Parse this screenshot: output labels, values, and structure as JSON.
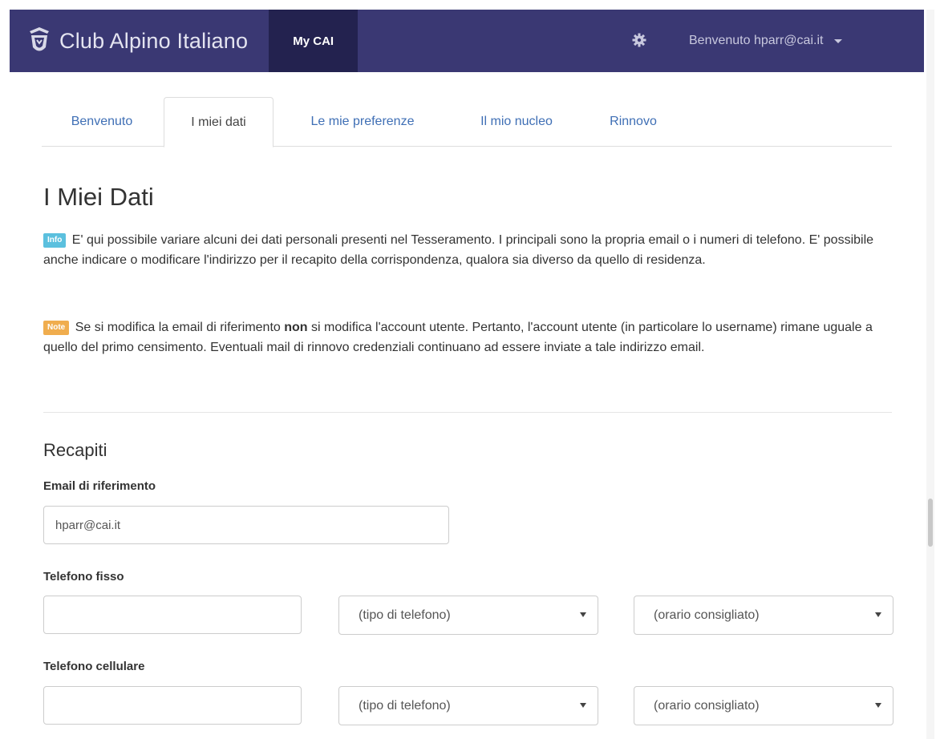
{
  "navbar": {
    "brand": "Club Alpino Italiano",
    "my_cai": "My CAI",
    "user_greeting": "Benvenuto hparr@cai.it",
    "icons": [
      "cai-logo-icon",
      "gear-icon",
      "caret-down-icon"
    ],
    "background_color": "#3a3873",
    "active_background_color": "#23224f"
  },
  "tabs": [
    {
      "label": "Benvenuto",
      "active": false
    },
    {
      "label": "I miei dati",
      "active": true
    },
    {
      "label": "Le mie preferenze",
      "active": false
    },
    {
      "label": "Il mio nucleo",
      "active": false
    },
    {
      "label": "Rinnovo",
      "active": false
    }
  ],
  "page": {
    "title": "I Miei Dati",
    "info_badge": "Info",
    "info_text": "E' qui possibile variare alcuni dei dati personali presenti nel Tesseramento. I principali sono la propria email o i numeri di telefono. E' possibile anche indicare o modificare l'indirizzo per il recapito della corrispondenza, qualora sia diverso da quello di residenza.",
    "note_badge": "Note",
    "note_text_before": "Se si modifica la email di riferimento ",
    "note_text_bold": "non",
    "note_text_after": " si modifica l'account utente. Pertanto, l'account utente (in particolare lo username) rimane uguale a quello del primo censimento. Eventuali mail di rinnovo credenziali continuano ad essere inviate a tale indirizzo email."
  },
  "recapiti": {
    "section_title": "Recapiti",
    "email": {
      "label": "Email di riferimento",
      "value": "hparr@cai.it"
    },
    "fisso": {
      "label": "Telefono fisso",
      "value": "",
      "tipo_selected": "(tipo di telefono)",
      "orario_selected": "(orario consigliato)"
    },
    "cellulare": {
      "label": "Telefono cellulare",
      "value": "",
      "tipo_selected": "(tipo di telefono)",
      "orario_selected": "(orario consigliato)"
    }
  }
}
